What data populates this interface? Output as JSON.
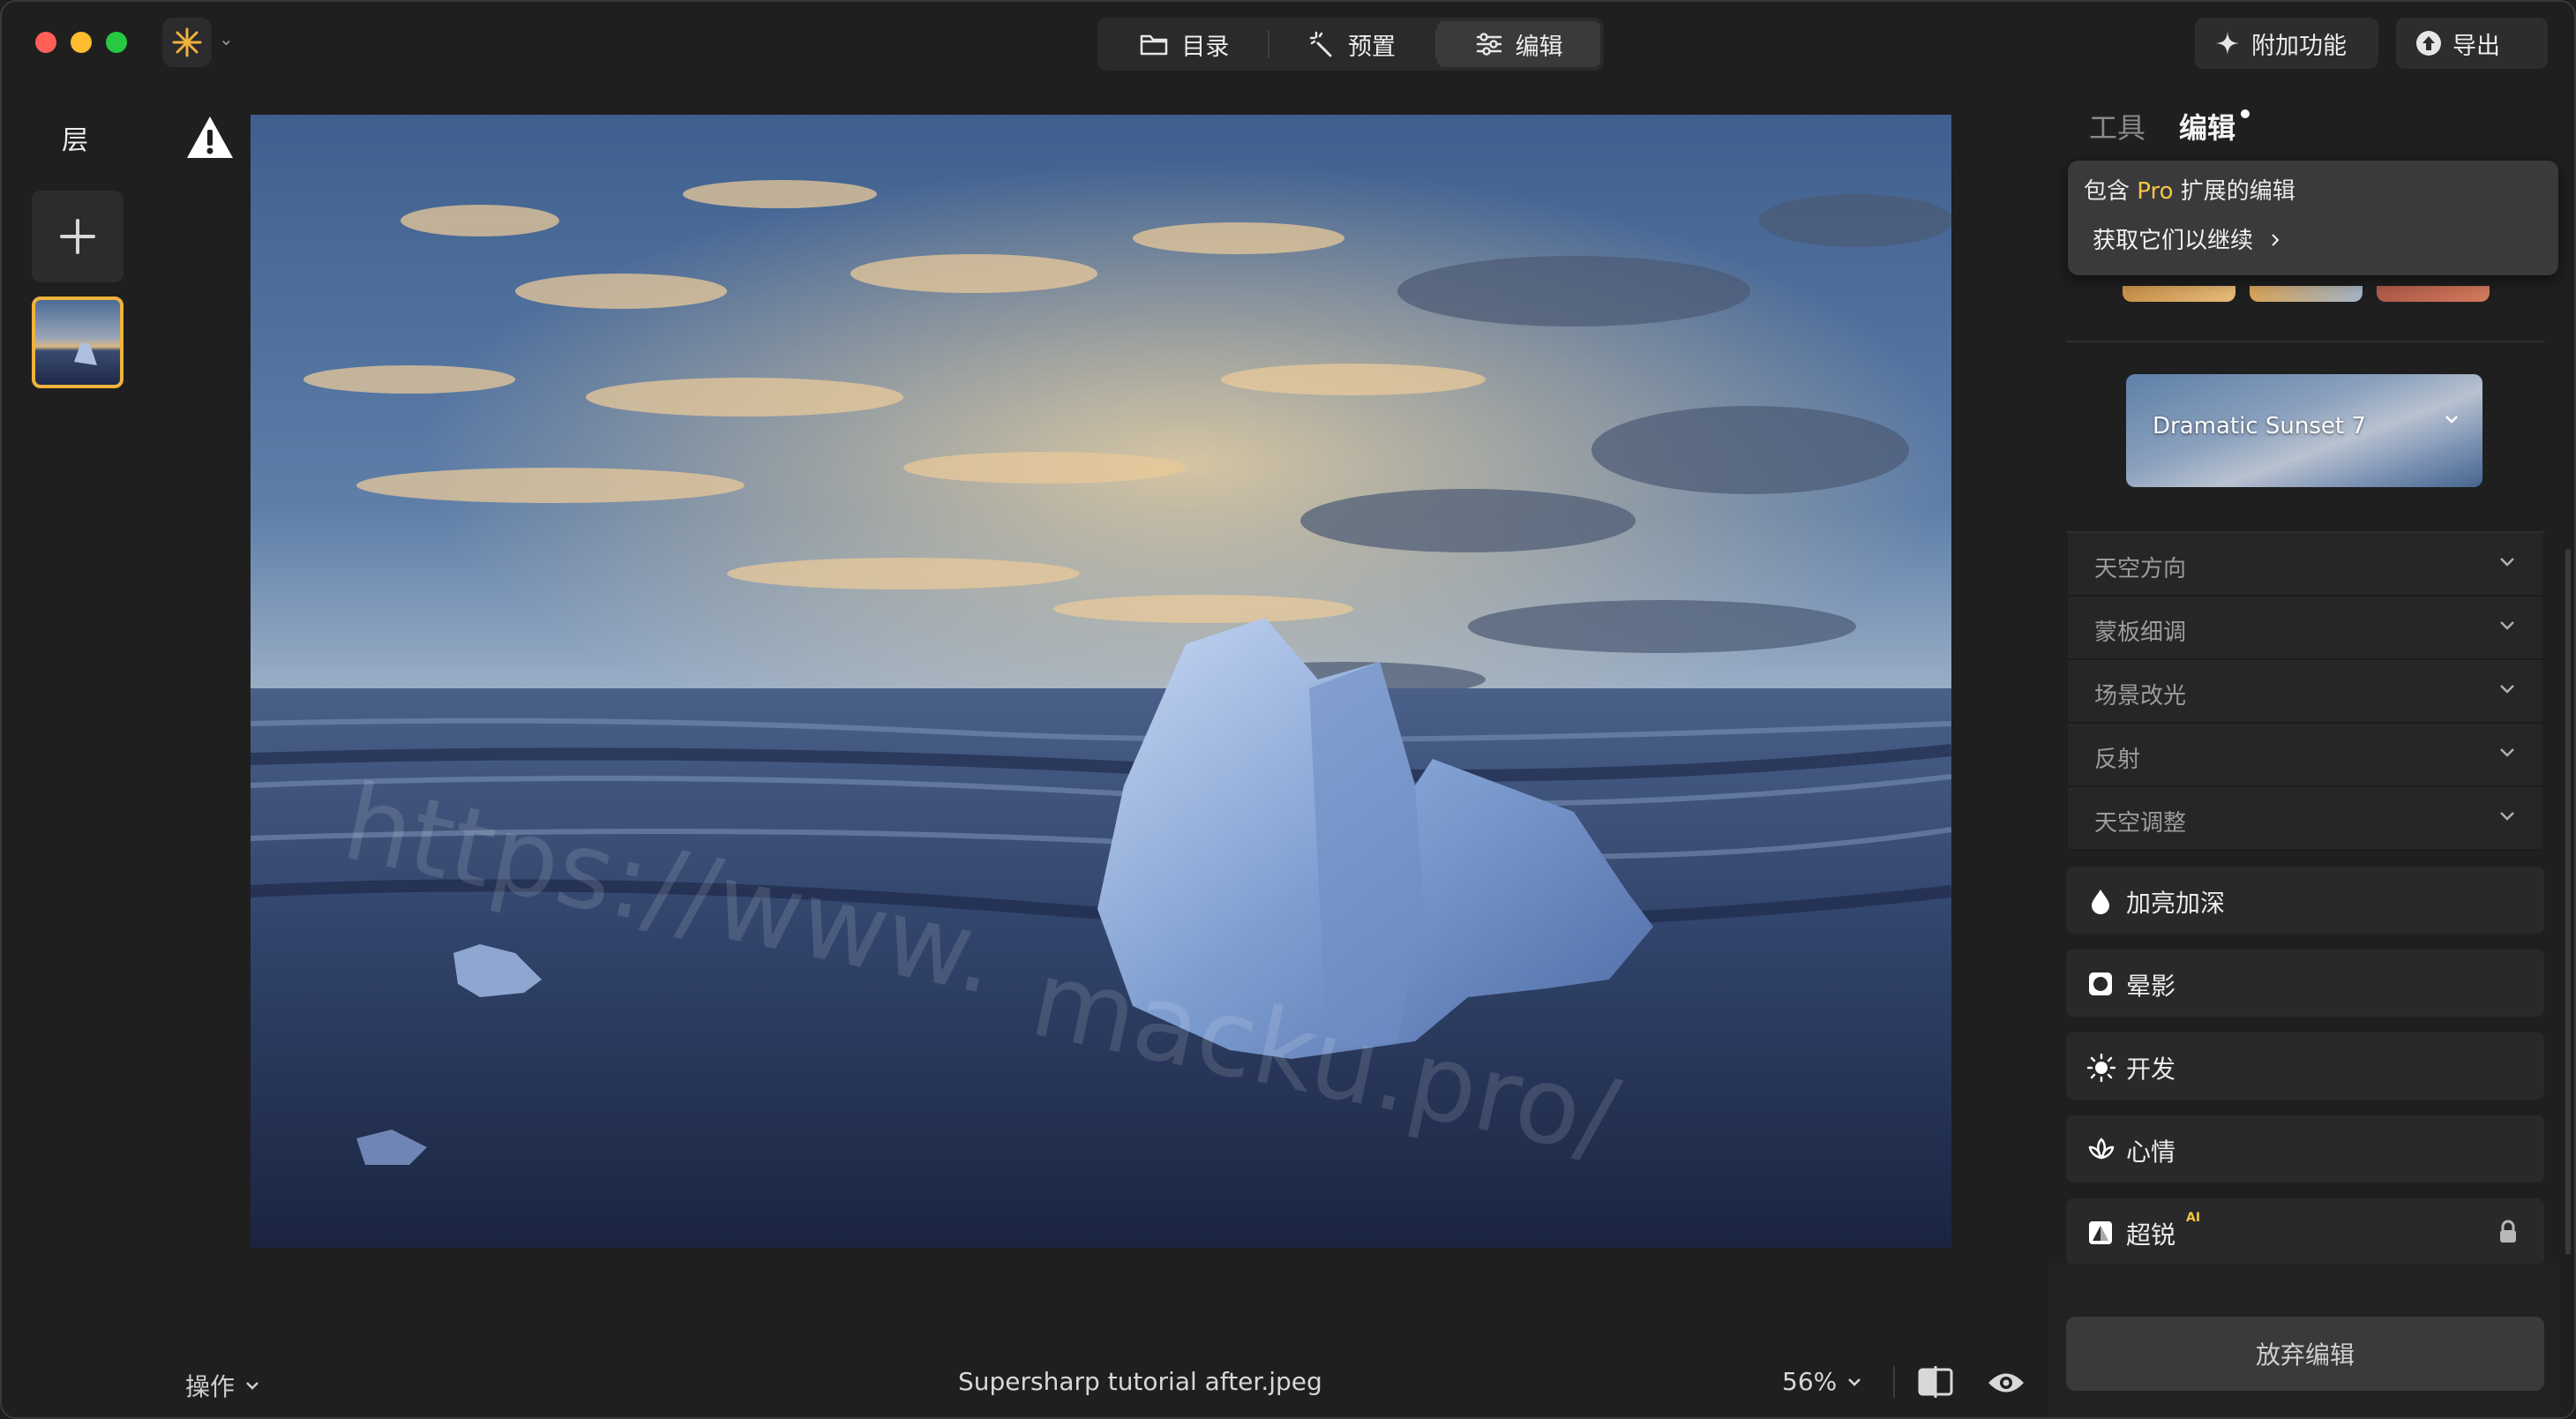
{
  "toolbar": {
    "segments": [
      {
        "label": "目录",
        "icon": "folder-icon"
      },
      {
        "label": "预置",
        "icon": "magic-wand-icon"
      },
      {
        "label": "编辑",
        "icon": "sliders-icon",
        "active": true
      }
    ],
    "addons_label": "附加功能",
    "export_label": "导出",
    "accent": "#f0b23c"
  },
  "layers": {
    "title": "层"
  },
  "bottom_bar": {
    "actions_label": "操作",
    "filename": "Supersharp tutorial after.jpeg",
    "zoom": "56%"
  },
  "right_panel": {
    "tab_tools": "工具",
    "tab_edits": "编辑",
    "pro_popup": {
      "prefix": "包含",
      "pro": "Pro",
      "suffix": "扩展的编辑",
      "link": "获取它们以继续"
    },
    "sky_preset": "Dramatic Sunset 7",
    "accordion": [
      "天空方向",
      "蒙板细调",
      "场景改光",
      "反射",
      "天空调整"
    ],
    "tools": [
      {
        "label": "加亮加深",
        "icon": "drop-icon"
      },
      {
        "label": "晕影",
        "icon": "vignette-icon"
      },
      {
        "label": "开发",
        "icon": "sun-icon"
      },
      {
        "label": "心情",
        "icon": "lotus-icon"
      },
      {
        "label": "超锐",
        "icon": "sharpen-icon",
        "badge": "AI",
        "locked": true
      }
    ],
    "discard_label": "放弃编辑"
  },
  "watermarks": [
    "https://www.macku.pro/",
    "macku.pro/"
  ]
}
